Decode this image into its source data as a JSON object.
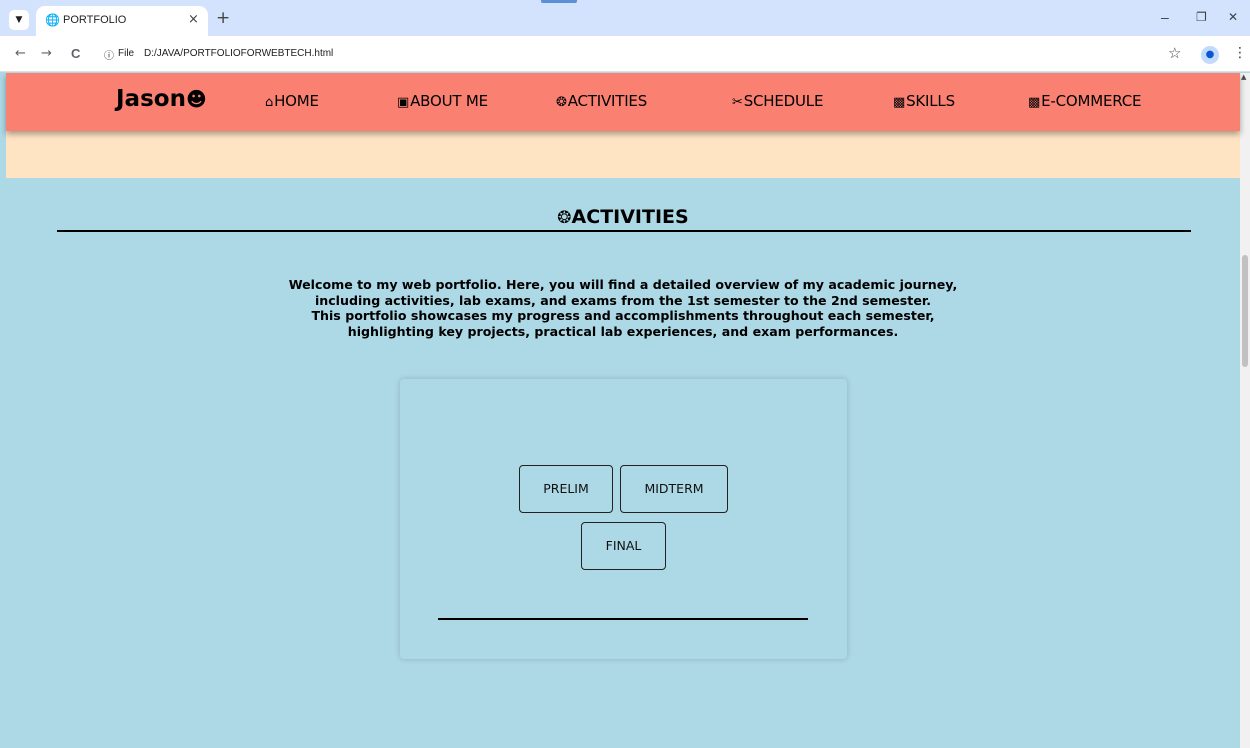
{
  "browser": {
    "tab_title": "PORTFOLIO",
    "tab_list_icon": "chevron-down-icon",
    "new_tab_glyph": "+",
    "tab_close_glyph": "×",
    "window": {
      "minimize": "–",
      "restore": "❐",
      "close": "✕"
    },
    "nav": {
      "back": "←",
      "forward": "→",
      "reload": "C"
    },
    "omnibox": {
      "scheme": "File",
      "url": "D:/JAVA/PORTFOLIOFORWEBTECH.html"
    },
    "star_glyph": "☆",
    "menu_glyph": "⋮"
  },
  "navbar": {
    "brand": "Jason",
    "brand_icon": "user-circle-icon",
    "items": [
      {
        "label": "HOME",
        "icon": "home-icon"
      },
      {
        "label": "ABOUT ME",
        "icon": "id-card-icon"
      },
      {
        "label": "ACTIVITIES",
        "icon": "atom-icon"
      },
      {
        "label": "SCHEDULE",
        "icon": "scissors-icon"
      },
      {
        "label": "SKILLS",
        "icon": "briefcase-icon"
      },
      {
        "label": "E-COMMERCE",
        "icon": "store-icon"
      }
    ]
  },
  "section": {
    "title": "ACTIVITIES",
    "icon": "atom-icon",
    "intro": [
      "Welcome to my web portfolio. Here, you will find a detailed overview of my academic journey,",
      "including activities, lab exams, and exams from the 1st semester to the 2nd semester.",
      "This portfolio showcases my progress and accomplishments throughout each semester,",
      "highlighting key projects, practical lab experiences, and exam performances."
    ]
  },
  "terms": {
    "prelim": "PRELIM",
    "midterm": "MIDTERM",
    "final": "FINAL"
  },
  "colors": {
    "navbar_bg": "#fa8072",
    "peach_band": "#ffe4c4",
    "page_bg": "#add8e6",
    "tabstrip_bg": "#d3e3fd"
  }
}
